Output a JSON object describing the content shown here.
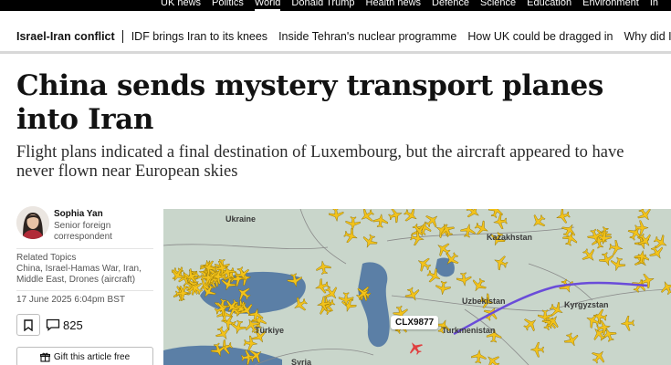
{
  "top_nav": {
    "items": [
      {
        "label": "UK news",
        "active": false
      },
      {
        "label": "Politics",
        "active": false
      },
      {
        "label": "World",
        "active": true
      },
      {
        "label": "Donald Trump",
        "active": false
      },
      {
        "label": "Health news",
        "active": false
      },
      {
        "label": "Defence",
        "active": false
      },
      {
        "label": "Science",
        "active": false
      },
      {
        "label": "Education",
        "active": false
      },
      {
        "label": "Environment",
        "active": false
      },
      {
        "label": "In",
        "active": false
      }
    ]
  },
  "sub_nav": {
    "section": "Israel-Iran conflict",
    "links": [
      "IDF brings Iran to its knees",
      "Inside Tehran's nuclear programme",
      "How UK could be dragged in",
      "Why did Israel atta"
    ]
  },
  "article": {
    "headline": "China sends mystery transport planes into Iran",
    "standfirst": "Flight plans indicated a final destination of Luxembourg, but the aircraft appeared to have never flown near European skies"
  },
  "author": {
    "name": "Sophia Yan",
    "role": "Senior foreign correspondent"
  },
  "related": {
    "title": "Related Topics",
    "topics": "China, Israel-Hamas War, Iran, Middle East, Drones (aircraft)"
  },
  "meta": {
    "date": "17 June 2025 6:04pm BST",
    "comment_count": "825"
  },
  "actions": {
    "gift_label": "Gift this article free"
  },
  "map": {
    "labels": [
      "Ukraine",
      "Kazakhstan",
      "Uzbekistan",
      "Kyrgyzstan",
      "Türkiye",
      "Turkmenistan",
      "Syria"
    ],
    "flight_tag": "CLX9877",
    "colors": {
      "land": "#c9d6cb",
      "sea": "#5b7fa6",
      "planes": "#f2c21b",
      "route": "#6a4cd9",
      "highlight": "#e04040"
    }
  },
  "icons": [
    "bookmark-icon",
    "comment-icon",
    "gift-icon"
  ]
}
